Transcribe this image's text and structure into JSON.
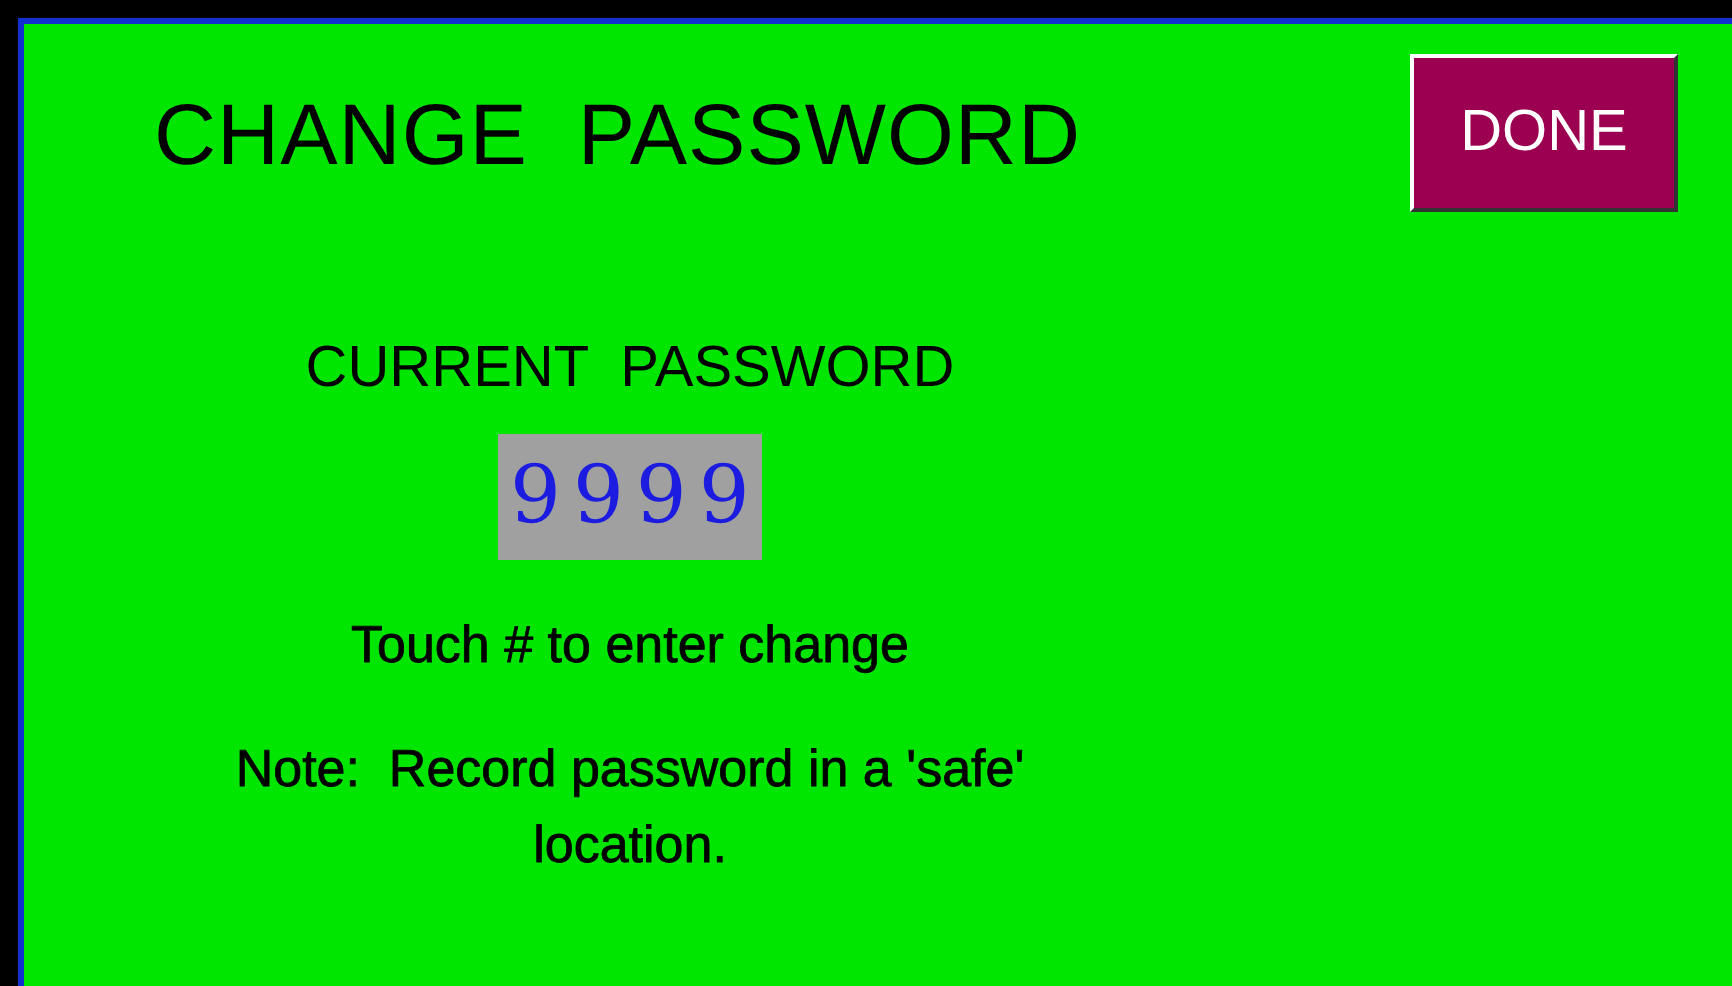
{
  "title": "CHANGE  PASSWORD",
  "done_button": "DONE",
  "current_password": {
    "label": "CURRENT  PASSWORD",
    "value": "9999"
  },
  "hint": "Touch # to enter change",
  "note": "Note:  Record password in a 'safe' location."
}
